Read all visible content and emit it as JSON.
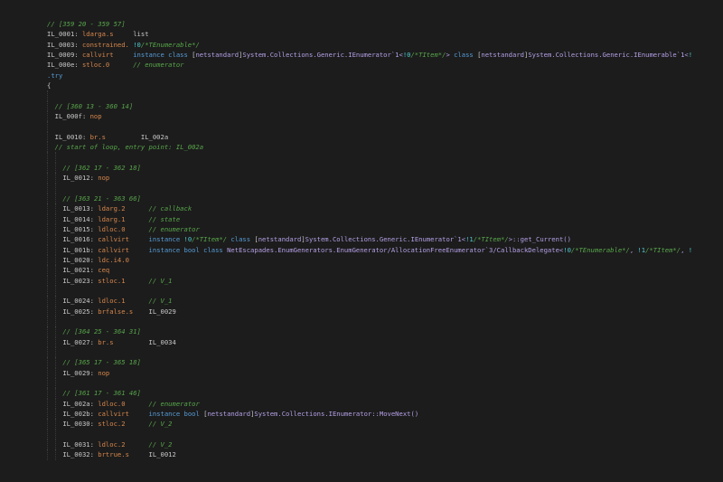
{
  "colors": {
    "background": "#1c1c1c",
    "comment": "#57a64a",
    "opcode": "#d7874c",
    "label": "#c8c8c8",
    "keyword": "#569cd6",
    "type": "#b4a0e6",
    "generic_param": "#4ec9d0"
  },
  "lines": [
    {
      "indent": 0,
      "tokens": [
        {
          "c": "cm",
          "t": "// [359 20 - 359 57]"
        }
      ]
    },
    {
      "indent": 0,
      "tokens": [
        {
          "c": "lb",
          "t": "IL_0001: "
        },
        {
          "c": "op",
          "t": "ldarga.s     "
        },
        {
          "c": "lb",
          "t": "list"
        }
      ]
    },
    {
      "indent": 0,
      "tokens": [
        {
          "c": "lb",
          "t": "IL_0003: "
        },
        {
          "c": "op",
          "t": "constrained. "
        },
        {
          "c": "gp",
          "t": "!0"
        },
        {
          "c": "cm",
          "t": "/*TEnumerable*/"
        }
      ]
    },
    {
      "indent": 0,
      "tokens": [
        {
          "c": "lb",
          "t": "IL_0009: "
        },
        {
          "c": "op",
          "t": "callvirt     "
        },
        {
          "c": "kw",
          "t": "instance class "
        },
        {
          "c": "pc",
          "t": "["
        },
        {
          "c": "ty",
          "t": "netstandard"
        },
        {
          "c": "pc",
          "t": "]"
        },
        {
          "c": "ty",
          "t": "System.Collections.Generic.IEnumerator`1<"
        },
        {
          "c": "gp",
          "t": "!0"
        },
        {
          "c": "cm",
          "t": "/*TItem*/"
        },
        {
          "c": "ty",
          "t": "> "
        },
        {
          "c": "kw",
          "t": "class "
        },
        {
          "c": "pc",
          "t": "["
        },
        {
          "c": "ty",
          "t": "netstandard"
        },
        {
          "c": "pc",
          "t": "]"
        },
        {
          "c": "ty",
          "t": "System.Collections.Generic.IEnumerable`1<"
        },
        {
          "c": "gp",
          "t": "!"
        }
      ]
    },
    {
      "indent": 0,
      "tokens": [
        {
          "c": "lb",
          "t": "IL_000e: "
        },
        {
          "c": "op",
          "t": "stloc.0      "
        },
        {
          "c": "cm",
          "t": "// enumerator"
        }
      ]
    },
    {
      "indent": 0,
      "tokens": [
        {
          "c": "br",
          "t": ".try"
        }
      ]
    },
    {
      "indent": 0,
      "tokens": [
        {
          "c": "pc",
          "t": "{"
        }
      ]
    },
    {
      "indent": 1,
      "tokens": []
    },
    {
      "indent": 1,
      "tokens": [
        {
          "c": "cm",
          "t": "// [360 13 - 360 14]"
        }
      ]
    },
    {
      "indent": 1,
      "tokens": [
        {
          "c": "lb",
          "t": "IL_000f: "
        },
        {
          "c": "op",
          "t": "nop"
        }
      ]
    },
    {
      "indent": 1,
      "tokens": []
    },
    {
      "indent": 1,
      "tokens": [
        {
          "c": "lb",
          "t": "IL_0010: "
        },
        {
          "c": "op",
          "t": "br.s         "
        },
        {
          "c": "lb",
          "t": "IL_002a"
        }
      ]
    },
    {
      "indent": 1,
      "tokens": [
        {
          "c": "cm",
          "t": "// start of loop, entry point: IL_002a"
        }
      ]
    },
    {
      "indent": 2,
      "tokens": []
    },
    {
      "indent": 2,
      "tokens": [
        {
          "c": "cm",
          "t": "// [362 17 - 362 18]"
        }
      ]
    },
    {
      "indent": 2,
      "tokens": [
        {
          "c": "lb",
          "t": "IL_0012: "
        },
        {
          "c": "op",
          "t": "nop"
        }
      ]
    },
    {
      "indent": 2,
      "tokens": []
    },
    {
      "indent": 2,
      "tokens": [
        {
          "c": "cm",
          "t": "// [363 21 - 363 66]"
        }
      ]
    },
    {
      "indent": 2,
      "tokens": [
        {
          "c": "lb",
          "t": "IL_0013: "
        },
        {
          "c": "op",
          "t": "ldarg.2      "
        },
        {
          "c": "cm",
          "t": "// callback"
        }
      ]
    },
    {
      "indent": 2,
      "tokens": [
        {
          "c": "lb",
          "t": "IL_0014: "
        },
        {
          "c": "op",
          "t": "ldarg.1      "
        },
        {
          "c": "cm",
          "t": "// state"
        }
      ]
    },
    {
      "indent": 2,
      "tokens": [
        {
          "c": "lb",
          "t": "IL_0015: "
        },
        {
          "c": "op",
          "t": "ldloc.0      "
        },
        {
          "c": "cm",
          "t": "// enumerator"
        }
      ]
    },
    {
      "indent": 2,
      "tokens": [
        {
          "c": "lb",
          "t": "IL_0016: "
        },
        {
          "c": "op",
          "t": "callvirt     "
        },
        {
          "c": "kw",
          "t": "instance "
        },
        {
          "c": "gp",
          "t": "!0"
        },
        {
          "c": "cm",
          "t": "/*TItem*/"
        },
        {
          "c": "kw",
          "t": " class "
        },
        {
          "c": "pc",
          "t": "["
        },
        {
          "c": "ty",
          "t": "netstandard"
        },
        {
          "c": "pc",
          "t": "]"
        },
        {
          "c": "ty",
          "t": "System.Collections.Generic.IEnumerator`1<"
        },
        {
          "c": "gp",
          "t": "!1"
        },
        {
          "c": "cm",
          "t": "/*TItem*/"
        },
        {
          "c": "ty",
          "t": ">::get_Current()"
        }
      ]
    },
    {
      "indent": 2,
      "tokens": [
        {
          "c": "lb",
          "t": "IL_001b: "
        },
        {
          "c": "op",
          "t": "callvirt     "
        },
        {
          "c": "kw",
          "t": "instance bool class "
        },
        {
          "c": "ty",
          "t": "NetEscapades.EnumGenerators.EnumGenerator/AllocationFreeEnumerator`3/CallbackDelegate<"
        },
        {
          "c": "gp",
          "t": "!0"
        },
        {
          "c": "cm",
          "t": "/*TEnumerable*/"
        },
        {
          "c": "ty",
          "t": ", "
        },
        {
          "c": "gp",
          "t": "!1"
        },
        {
          "c": "cm",
          "t": "/*TItem*/"
        },
        {
          "c": "ty",
          "t": ", "
        },
        {
          "c": "gp",
          "t": "!"
        }
      ]
    },
    {
      "indent": 2,
      "tokens": [
        {
          "c": "lb",
          "t": "IL_0020: "
        },
        {
          "c": "op",
          "t": "ldc.i4.0"
        }
      ]
    },
    {
      "indent": 2,
      "tokens": [
        {
          "c": "lb",
          "t": "IL_0021: "
        },
        {
          "c": "op",
          "t": "ceq"
        }
      ]
    },
    {
      "indent": 2,
      "tokens": [
        {
          "c": "lb",
          "t": "IL_0023: "
        },
        {
          "c": "op",
          "t": "stloc.1      "
        },
        {
          "c": "cm",
          "t": "// V_1"
        }
      ]
    },
    {
      "indent": 2,
      "tokens": []
    },
    {
      "indent": 2,
      "tokens": [
        {
          "c": "lb",
          "t": "IL_0024: "
        },
        {
          "c": "op",
          "t": "ldloc.1      "
        },
        {
          "c": "cm",
          "t": "// V_1"
        }
      ]
    },
    {
      "indent": 2,
      "tokens": [
        {
          "c": "lb",
          "t": "IL_0025: "
        },
        {
          "c": "op",
          "t": "brfalse.s    "
        },
        {
          "c": "lb",
          "t": "IL_0029"
        }
      ]
    },
    {
      "indent": 2,
      "tokens": []
    },
    {
      "indent": 2,
      "tokens": [
        {
          "c": "cm",
          "t": "// [364 25 - 364 31]"
        }
      ]
    },
    {
      "indent": 2,
      "tokens": [
        {
          "c": "lb",
          "t": "IL_0027: "
        },
        {
          "c": "op",
          "t": "br.s         "
        },
        {
          "c": "lb",
          "t": "IL_0034"
        }
      ]
    },
    {
      "indent": 2,
      "tokens": []
    },
    {
      "indent": 2,
      "tokens": [
        {
          "c": "cm",
          "t": "// [365 17 - 365 18]"
        }
      ]
    },
    {
      "indent": 2,
      "tokens": [
        {
          "c": "lb",
          "t": "IL_0029: "
        },
        {
          "c": "op",
          "t": "nop"
        }
      ]
    },
    {
      "indent": 2,
      "tokens": []
    },
    {
      "indent": 2,
      "tokens": [
        {
          "c": "cm",
          "t": "// [361 17 - 361 46]"
        }
      ]
    },
    {
      "indent": 2,
      "tokens": [
        {
          "c": "lb",
          "t": "IL_002a: "
        },
        {
          "c": "op",
          "t": "ldloc.0      "
        },
        {
          "c": "cm",
          "t": "// enumerator"
        }
      ]
    },
    {
      "indent": 2,
      "tokens": [
        {
          "c": "lb",
          "t": "IL_002b: "
        },
        {
          "c": "op",
          "t": "callvirt     "
        },
        {
          "c": "kw",
          "t": "instance bool "
        },
        {
          "c": "pc",
          "t": "["
        },
        {
          "c": "ty",
          "t": "netstandard"
        },
        {
          "c": "pc",
          "t": "]"
        },
        {
          "c": "ty",
          "t": "System.Collections.IEnumerator::MoveNext()"
        }
      ]
    },
    {
      "indent": 2,
      "tokens": [
        {
          "c": "lb",
          "t": "IL_0030: "
        },
        {
          "c": "op",
          "t": "stloc.2      "
        },
        {
          "c": "cm",
          "t": "// V_2"
        }
      ]
    },
    {
      "indent": 2,
      "tokens": []
    },
    {
      "indent": 2,
      "tokens": [
        {
          "c": "lb",
          "t": "IL_0031: "
        },
        {
          "c": "op",
          "t": "ldloc.2      "
        },
        {
          "c": "cm",
          "t": "// V_2"
        }
      ]
    },
    {
      "indent": 2,
      "tokens": [
        {
          "c": "lb",
          "t": "IL_0032: "
        },
        {
          "c": "op",
          "t": "brtrue.s     "
        },
        {
          "c": "lb",
          "t": "IL_0012"
        }
      ]
    }
  ]
}
